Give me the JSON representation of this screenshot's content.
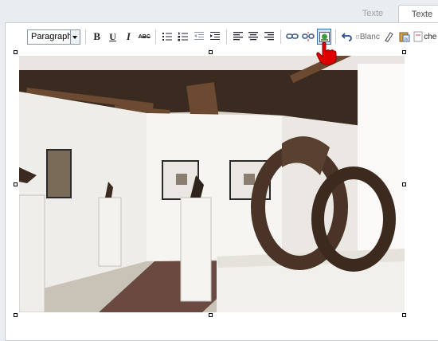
{
  "tabs": [
    {
      "label": "Texte",
      "active": false
    },
    {
      "label": "Texte",
      "active": true
    }
  ],
  "toolbar": {
    "format_select": "Paragraph",
    "buttons": [
      {
        "name": "bold-button",
        "label": "B"
      },
      {
        "name": "underline-button",
        "label": "U"
      },
      {
        "name": "italic-button",
        "label": "I"
      },
      {
        "name": "strikethrough-button",
        "label": "ABC"
      },
      {
        "name": "bullet-list-icon"
      },
      {
        "name": "numbered-list-icon"
      },
      {
        "name": "outdent-icon"
      },
      {
        "name": "indent-icon"
      },
      {
        "name": "align-left-icon"
      },
      {
        "name": "align-center-icon"
      },
      {
        "name": "align-right-icon"
      },
      {
        "name": "link-icon"
      },
      {
        "name": "unlink-icon"
      },
      {
        "name": "insert-image-icon",
        "state": "pressed"
      },
      {
        "name": "undo-icon"
      },
      {
        "name": "paste-plain-text-icon"
      },
      {
        "name": "clean-format-icon"
      },
      {
        "name": "paste-word-icon"
      },
      {
        "name": "search-icon"
      }
    ],
    "truncated_labels": {
      "blanc": "Blanc",
      "search": "che"
    }
  },
  "image": {
    "subject": "gallery-photo"
  },
  "colors": {
    "background": "#e9edf0",
    "panel_border": "#c7cdd2",
    "active_button_border": "#3a6fa8",
    "active_button_fill": "#cfe1f3",
    "cursor": "#e00000"
  }
}
